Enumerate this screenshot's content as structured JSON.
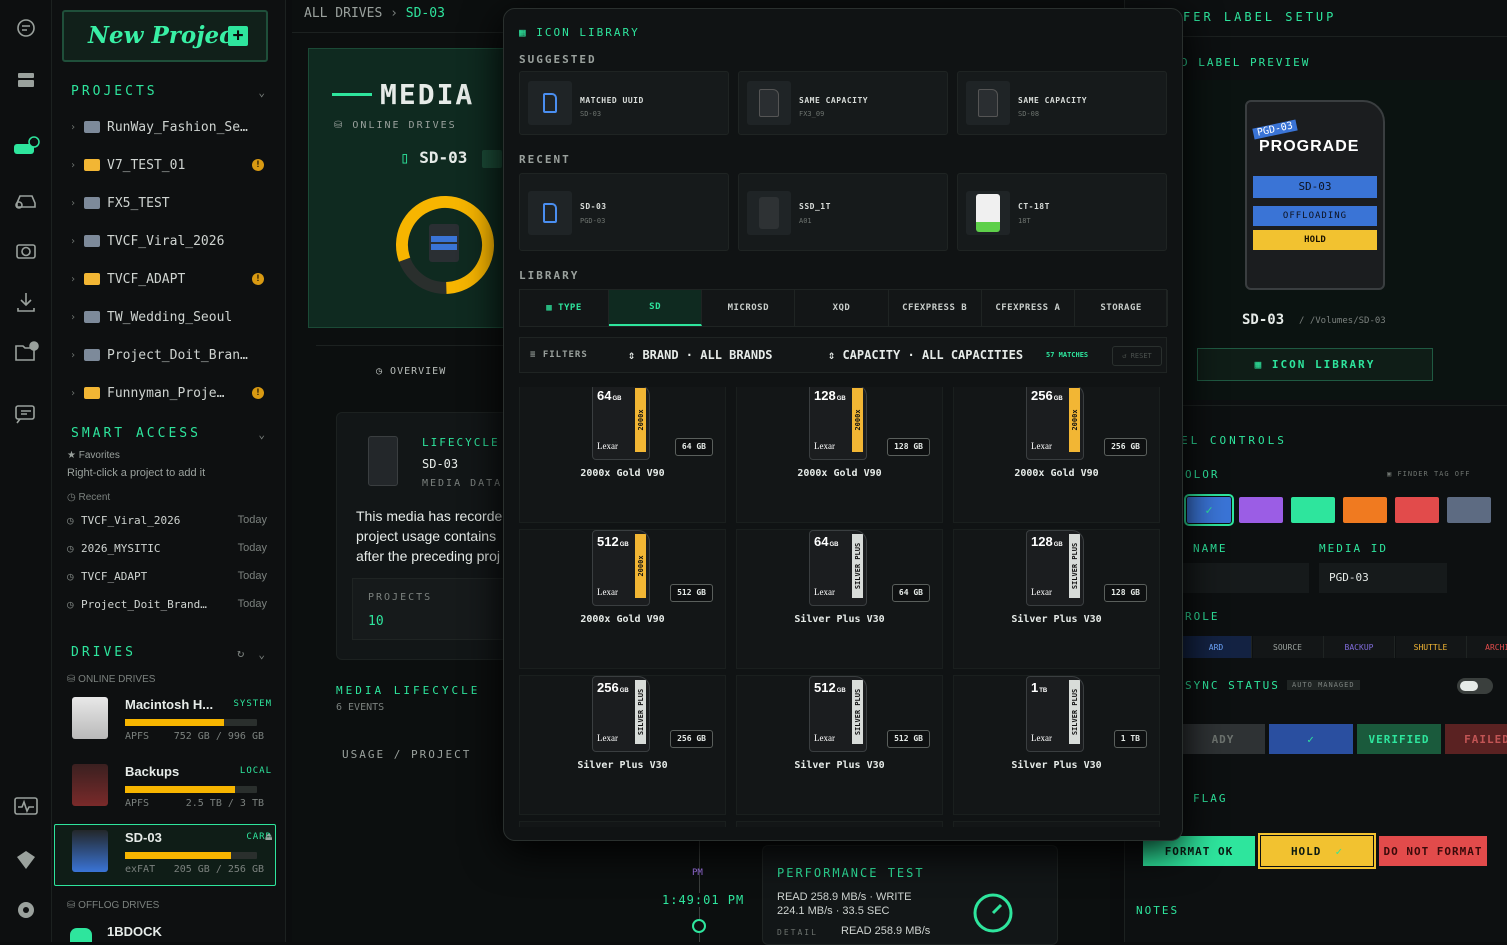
{
  "sidebar": {
    "new_project": "New Project",
    "projects_title": "PROJECTS",
    "projects": [
      {
        "name": "RunWay_Fashion_Se…",
        "flag": false
      },
      {
        "name": "V7_TEST_01",
        "flag": true
      },
      {
        "name": "FX5_TEST",
        "flag": false
      },
      {
        "name": "TVCF_Viral_2026",
        "flag": false
      },
      {
        "name": "TVCF_ADAPT",
        "flag": true
      },
      {
        "name": "TW_Wedding_Seoul",
        "flag": false
      },
      {
        "name": "Project_Doit_Bran…",
        "flag": false
      },
      {
        "name": "Funnyman_Proje…",
        "flag": true
      }
    ],
    "smart_access_title": "SMART ACCESS",
    "favorites_label": "Favorites",
    "favorites_hint": "Right-click a project to add it",
    "recent_label": "Recent",
    "recent": [
      {
        "name": "TVCF_Viral_2026",
        "date": "Today"
      },
      {
        "name": "2026_MYSITIC",
        "date": "Today"
      },
      {
        "name": "TVCF_ADAPT",
        "date": "Today"
      },
      {
        "name": "Project_Doit_Brand…",
        "date": "Today"
      }
    ],
    "drives_title": "DRIVES",
    "online_drives_label": "ONLINE DRIVES",
    "drives": [
      {
        "name": "Macintosh H...",
        "tag": "SYSTEM",
        "fs": "APFS",
        "size": "752 GB / 996 GB",
        "usage": 0.75
      },
      {
        "name": "Backups",
        "tag": "LOCAL",
        "fs": "APFS",
        "size": "2.5 TB / 3 TB",
        "usage": 0.83
      },
      {
        "name": "SD-03",
        "tag": "CARD",
        "fs": "exFAT",
        "size": "205 GB / 256 GB",
        "usage": 0.8
      }
    ],
    "offlog_drives_label": "OFFLOG DRIVES",
    "offline_drive": "1BDOCK"
  },
  "breadcrumb": {
    "root": "ALL DRIVES",
    "sep": "›",
    "current": "SD-03"
  },
  "center": {
    "hero_title": "MEDIA",
    "online_drives": "ONLINE DRIVES",
    "drive_name": "SD-03",
    "overview_tab": "OVERVIEW",
    "lifecycle_title": "LIFECYCLE",
    "lifecycle_drive": "SD-03",
    "lifecycle_sub": "MEDIA DATA",
    "lifecycle_text": "This media has recorde project usage contains after the preceding proj",
    "projects_label": "PROJECTS",
    "projects_value": "10",
    "media_lifecycle_title": "MEDIA LIFECYCLE",
    "media_lifecycle_events": "6 EVENTS",
    "usage_project": "USAGE / PROJECT",
    "timeline_time": "1:49:01 PM",
    "timeline_marker": "PM",
    "perf_title": "PERFORMANCE TEST",
    "perf_text": "READ 258.9 MB/s · WRITE 224.1 MB/s · 33.5 SEC",
    "perf_detail_label": "DETAIL",
    "perf_detail_value": "READ 258.9 MB/s"
  },
  "modal": {
    "title": "ICON LIBRARY",
    "suggested_label": "SUGGESTED",
    "suggested": [
      {
        "title": "MATCHED UUID",
        "sub": "SD-03"
      },
      {
        "title": "SAME CAPACITY",
        "sub": "FX3_09"
      },
      {
        "title": "SAME CAPACITY",
        "sub": "SD-08"
      }
    ],
    "recent_label": "RECENT",
    "recent": [
      {
        "title": "SD-03",
        "sub": "PGD-03"
      },
      {
        "title": "SSD_1T",
        "sub": "A01"
      },
      {
        "title": "CT-18T",
        "sub": "18T"
      }
    ],
    "library_label": "LIBRARY",
    "type_label": "TYPE",
    "tabs": [
      "SD",
      "MICROSD",
      "XQD",
      "CFEXPRESS B",
      "CFEXPRESS A",
      "STORAGE"
    ],
    "filters_label": "FILTERS",
    "brand_label": "BRAND",
    "brand_value": "ALL BRANDS",
    "capacity_label": "CAPACITY",
    "capacity_value": "ALL CAPACITIES",
    "matches": "57 MATCHES",
    "reset": "RESET",
    "cards": [
      {
        "num": "64",
        "unit": "GB",
        "cap": "64 GB",
        "name": "2000x Gold V90",
        "stripe": "#f2b634",
        "stripe_text": "2000x"
      },
      {
        "num": "128",
        "unit": "GB",
        "cap": "128 GB",
        "name": "2000x Gold V90",
        "stripe": "#f2b634",
        "stripe_text": "2000x"
      },
      {
        "num": "256",
        "unit": "GB",
        "cap": "256 GB",
        "name": "2000x Gold V90",
        "stripe": "#f2b634",
        "stripe_text": "2000x"
      },
      {
        "num": "512",
        "unit": "GB",
        "cap": "512 GB",
        "name": "2000x Gold V90",
        "stripe": "#f2b634",
        "stripe_text": "2000x"
      },
      {
        "num": "64",
        "unit": "GB",
        "cap": "64 GB",
        "name": "Silver Plus V30",
        "stripe": "#d8dcd9",
        "stripe_text": "SILVER PLUS"
      },
      {
        "num": "128",
        "unit": "GB",
        "cap": "128 GB",
        "name": "Silver Plus V30",
        "stripe": "#d8dcd9",
        "stripe_text": "SILVER PLUS"
      },
      {
        "num": "256",
        "unit": "GB",
        "cap": "256 GB",
        "name": "Silver Plus V30",
        "stripe": "#d8dcd9",
        "stripe_text": "SILVER PLUS"
      },
      {
        "num": "512",
        "unit": "GB",
        "cap": "512 GB",
        "name": "Silver Plus V30",
        "stripe": "#d8dcd9",
        "stripe_text": "SILVER PLUS"
      },
      {
        "num": "1",
        "unit": "TB",
        "cap": "1 TB",
        "name": "Silver Plus V30",
        "stripe": "#d8dcd9",
        "stripe_text": "SILVER PLUS"
      }
    ],
    "sd_brand": "Lexar"
  },
  "right": {
    "title": "FER LABEL SETUP",
    "preview_label": "D LABEL PREVIEW",
    "card_brand": "PROGRADE",
    "card_id": "PGD-03",
    "card_label_1": "SD-03",
    "card_label_2": "OFFLOADING",
    "card_label_3": "HOLD",
    "drive_name": "SD-03",
    "drive_path": "/Volumes/SD-03",
    "icon_library_button": "ICON LIBRARY",
    "controls_label": "EL CONTROLS",
    "color_label": "OLOR",
    "finder_tag": "FINDER TAG OFF",
    "colors": [
      "#3a74d6",
      "#9b5de5",
      "#2ee59d",
      "#f07a20",
      "#e24b4b",
      "#5d6b82"
    ],
    "name_label": "NAME",
    "media_id_label": "MEDIA ID",
    "media_id_value": "PGD-03",
    "role_label": "ROLE",
    "roles": [
      "ARD",
      "SOURCE",
      "BACKUP",
      "SHUTTLE",
      "ARCHIVE"
    ],
    "sync_label": "SYNC STATUS",
    "sync_badge": "AUTO MANAGED",
    "sync_states": [
      "ADY",
      "",
      "VERIFIED",
      "FAILED"
    ],
    "flag_label": "FLAG",
    "flags": [
      "FORMAT OK",
      "HOLD",
      "DO NOT FORMAT"
    ],
    "notes_label": "NOTES"
  }
}
